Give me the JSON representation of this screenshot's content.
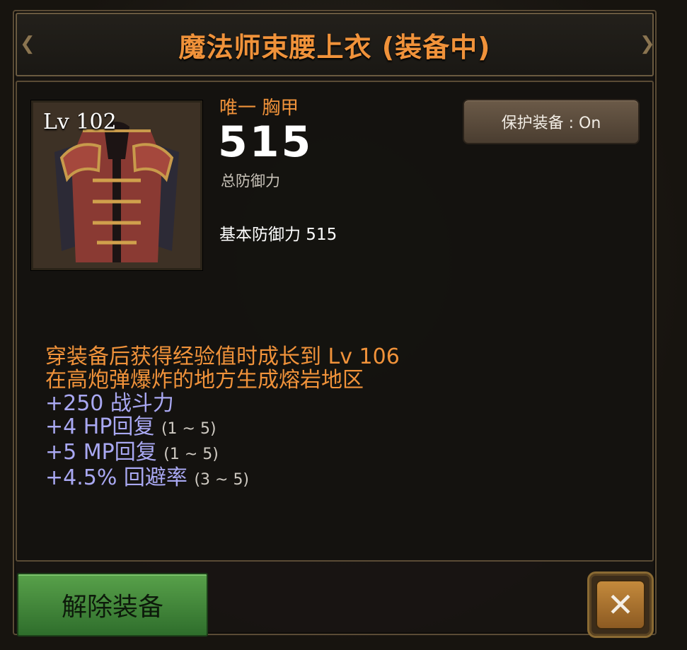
{
  "title": "魔法师束腰上衣 (装备中)",
  "item": {
    "level": "Lv 102",
    "rarity_slot": "唯一 胸甲",
    "total_defense": "515",
    "total_defense_label": "总防御力",
    "base_defense": "基本防御力 515"
  },
  "protect_button": "保护装备 : On",
  "effects": [
    {
      "text": "穿装备后获得经验值时成长到 Lv 106",
      "range": "",
      "style": "orange"
    },
    {
      "text": "在高炮弹爆炸的地方生成熔岩地区",
      "range": "",
      "style": "orange"
    },
    {
      "text": "+250 战斗力",
      "range": "",
      "style": "blue"
    },
    {
      "text": "+4 HP回复",
      "range": "(1 ~ 5)",
      "style": "blue"
    },
    {
      "text": "+5 MP回复",
      "range": "(1 ~ 5)",
      "style": "blue"
    },
    {
      "text": "+4.5% 回避率",
      "range": "(3 ~ 5)",
      "style": "blue"
    }
  ],
  "unequip_button": "解除装备",
  "colors": {
    "accent_orange": "#f0923a",
    "stat_blue": "#a9a8f2",
    "button_green": "#4a8f3f"
  },
  "icons": {
    "close": "close-x-icon"
  }
}
